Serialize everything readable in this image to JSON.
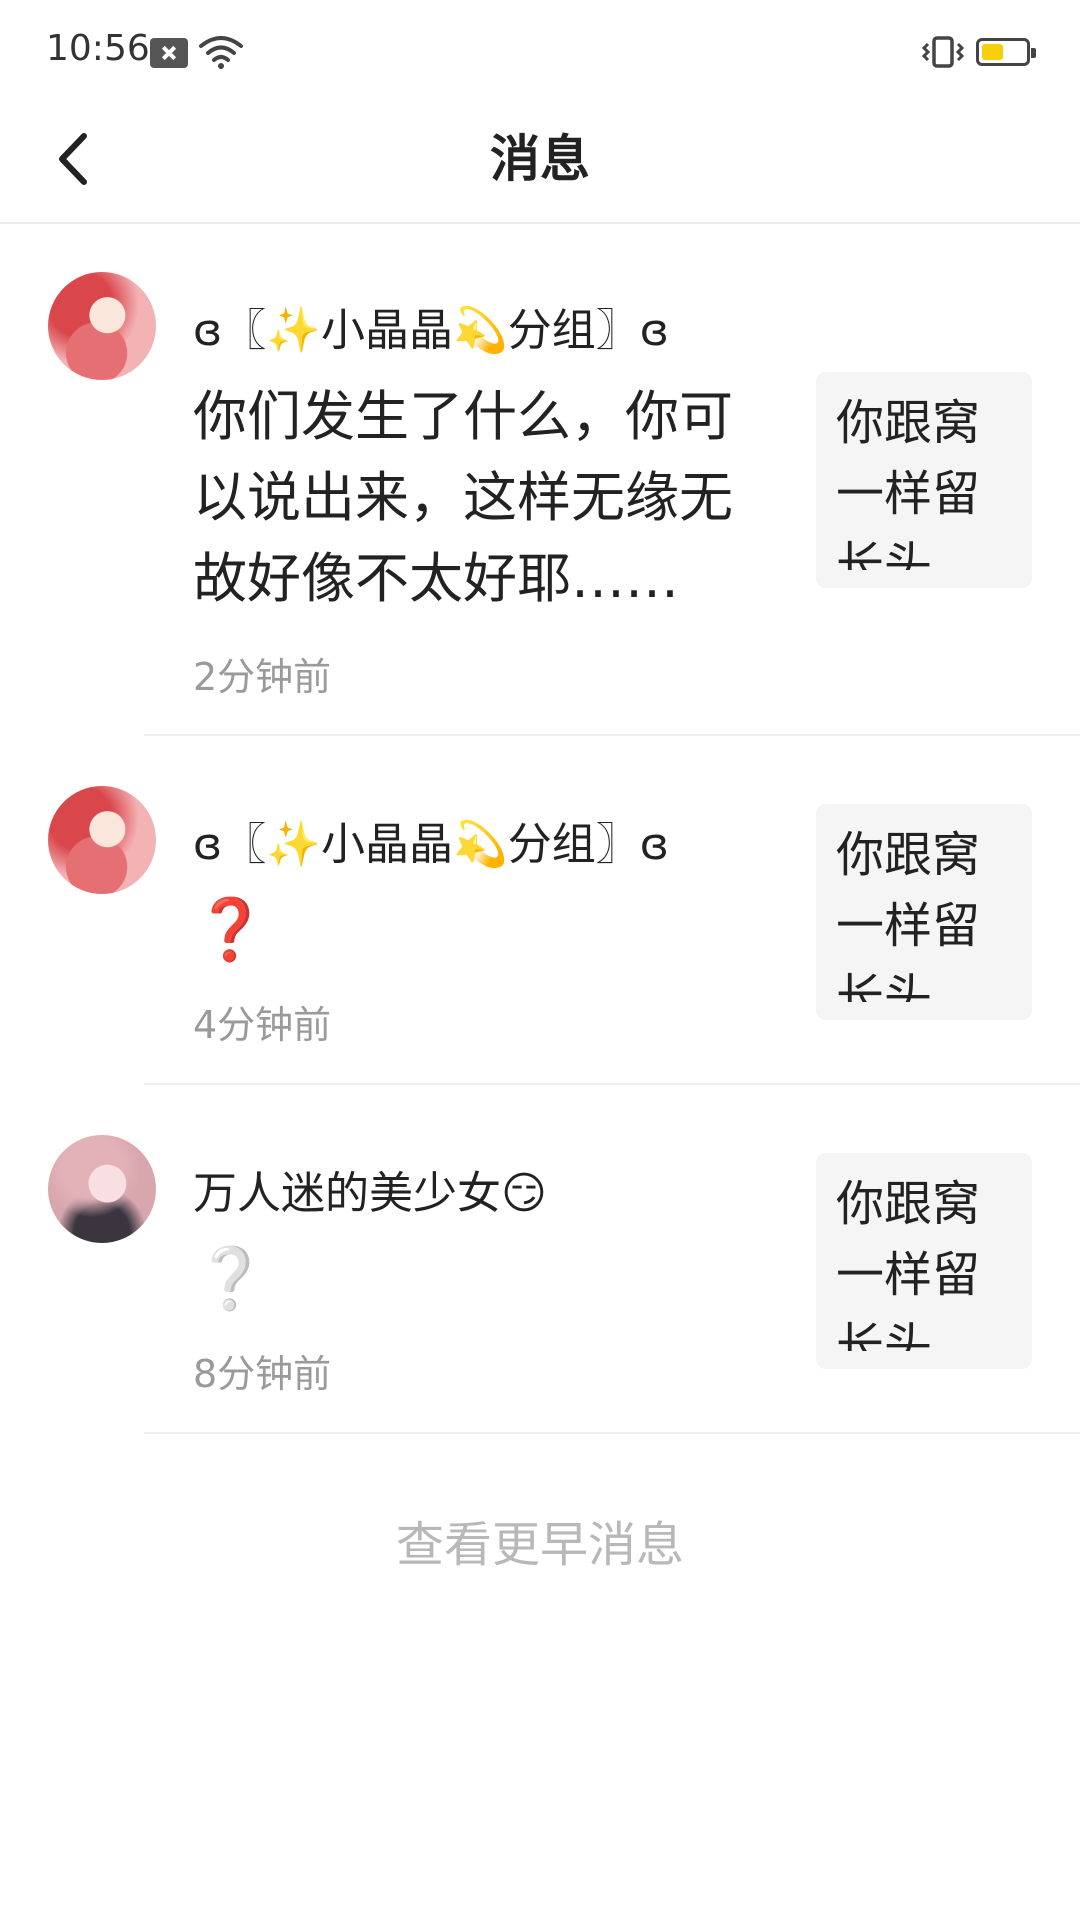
{
  "status_bar": {
    "time": "10:56",
    "battery_level": 0.5,
    "battery_color": "#f6d10a"
  },
  "header": {
    "title": "消息"
  },
  "messages": [
    {
      "sender": "ɞ〖✨小晶晶💫分组〗ɞ",
      "content": "你们发生了什么，你可以说出来，这样无缘无故好像不太好耶……",
      "time": "2分钟前",
      "quote": "你跟窝一样留长头(ゝ"
    },
    {
      "sender": "ɞ〖✨小晶晶💫分组〗ɞ",
      "content": "❓",
      "time": "4分钟前",
      "quote": "你跟窝一样留长头(ゝ"
    },
    {
      "sender": "万人迷的美少女😏",
      "content": "❔",
      "time": "8分钟前",
      "quote": "你跟窝一样留长头(ゝ"
    }
  ],
  "footer": {
    "more_label": "查看更早消息"
  },
  "colors": {
    "divider": "#efefef",
    "secondary_text": "#9a9a9a",
    "more_text": "#b8b8b8",
    "quote_bg": "#f5f5f5"
  }
}
